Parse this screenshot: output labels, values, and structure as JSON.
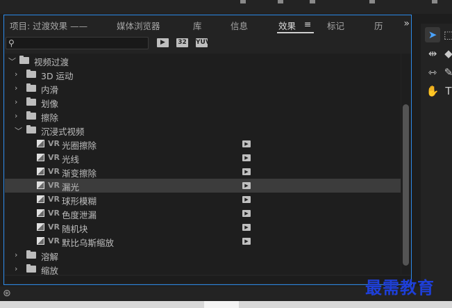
{
  "tabs": [
    {
      "label": "项目: 过渡效果 ——"
    },
    {
      "label": "媒体浏览器"
    },
    {
      "label": "库"
    },
    {
      "label": "信息"
    },
    {
      "label": "效果"
    },
    {
      "label": "标记"
    },
    {
      "label": "历"
    }
  ],
  "active_tab_menu": "≡",
  "overflow_label": "»",
  "search": {
    "value": "",
    "placeholder": ""
  },
  "filters": [
    {
      "label": "▶"
    },
    {
      "label": "32"
    },
    {
      "label": "YUV"
    }
  ],
  "tree": {
    "root": "视频过渡",
    "folders_before": [
      "3D 运动",
      "内滑",
      "划像",
      "擦除"
    ],
    "open_folder": "沉浸式视频",
    "effects": [
      {
        "badge": "VR",
        "name": "光圈擦除"
      },
      {
        "badge": "VR",
        "name": "光线"
      },
      {
        "badge": "VR",
        "name": "渐变擦除"
      },
      {
        "badge": "VR",
        "name": "漏光"
      },
      {
        "badge": "VR",
        "name": "球形模糊"
      },
      {
        "badge": "VR",
        "name": "色度泄漏"
      },
      {
        "badge": "VR",
        "name": "随机块"
      },
      {
        "badge": "VR",
        "name": "默比乌斯缩放"
      }
    ],
    "folders_after": [
      "溶解",
      "缩放"
    ],
    "selected_effect": "漏光"
  },
  "watermark": "最需教育",
  "colors": {
    "accent": "#2d8ceb",
    "selection": "#3c3c3c",
    "watermark": "#1e3fd8"
  }
}
